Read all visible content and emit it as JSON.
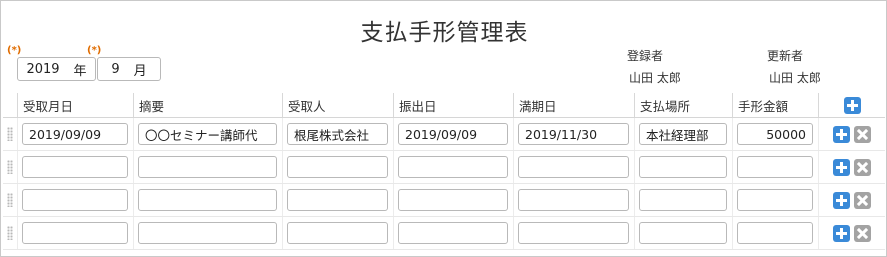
{
  "form": {
    "title": "支払手形管理表",
    "required_marker": "(*)",
    "year": {
      "value": "2019",
      "unit": "年"
    },
    "month": {
      "value": "9",
      "unit": "月"
    },
    "registrant": {
      "label": "登録者",
      "value": "山田 太郎"
    },
    "updater": {
      "label": "更新者",
      "value": "山田 太郎"
    }
  },
  "table": {
    "columns": [
      "受取月日",
      "摘要",
      "受取人",
      "振出日",
      "満期日",
      "支払場所",
      "手形金額"
    ],
    "rows": [
      [
        "2019/09/09",
        "〇〇セミナー講師代",
        "根尾株式会社",
        "2019/09/09",
        "2019/11/30",
        "本社経理部",
        "50000"
      ],
      [
        "",
        "",
        "",
        "",
        "",
        "",
        ""
      ],
      [
        "",
        "",
        "",
        "",
        "",
        "",
        ""
      ],
      [
        "",
        "",
        "",
        "",
        "",
        "",
        ""
      ]
    ]
  },
  "icons": {
    "add": "plus-icon",
    "remove": "close-icon",
    "drag": "drag-handle-icon"
  },
  "colors": {
    "add_button": "#3a8ad8",
    "remove_button": "#a3a3a3",
    "required_marker": "#e06c00"
  }
}
